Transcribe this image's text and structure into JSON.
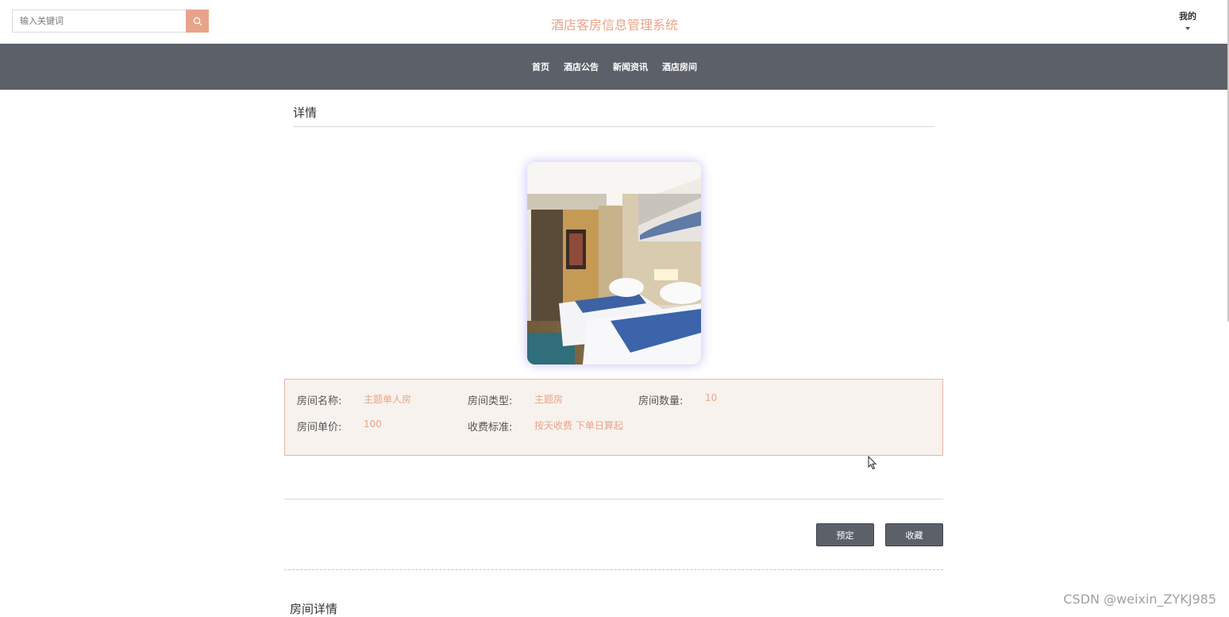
{
  "header": {
    "search_placeholder": "输入关键词",
    "site_title": "酒店客房信息管理系统",
    "user_menu_label": "我的",
    "search_icon": "search-icon",
    "caret_icon": "caret-down-icon"
  },
  "nav": {
    "items": [
      "首页",
      "酒店公告",
      "新闻资讯",
      "酒店房间"
    ]
  },
  "detail": {
    "heading": "详情",
    "photo_alt": "hotel room photo"
  },
  "info": {
    "name_label": "房间名称:",
    "name_value": "主题单人房",
    "type_label": "房间类型:",
    "type_value": "主题房",
    "count_label": "房间数量:",
    "count_value": "10",
    "price_label": "房间单价:",
    "price_value": "100",
    "charge_label": "收费标准:",
    "charge_value": "按天收费 下单日算起"
  },
  "actions": {
    "book_label": "预定",
    "favorite_label": "收藏"
  },
  "room_detail": {
    "title": "房间详情"
  },
  "watermark": "CSDN @weixin_ZYKJ985",
  "colors": {
    "accent": "#e8a48a",
    "nav_bg": "#5c6169",
    "info_bg": "#f8f2ee"
  }
}
